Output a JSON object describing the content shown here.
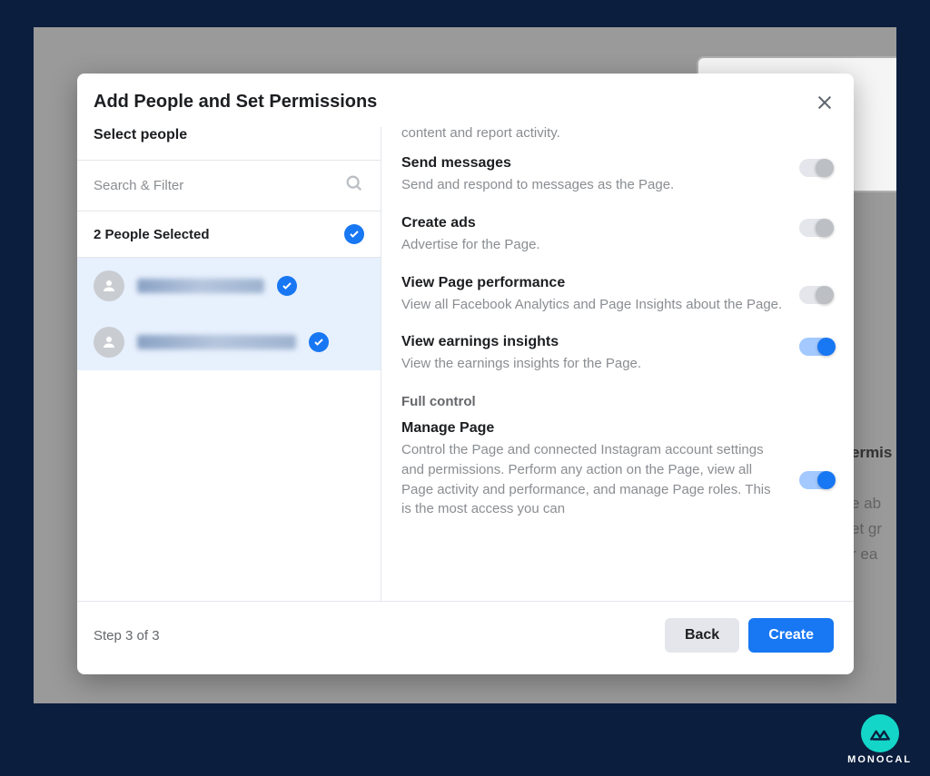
{
  "modal": {
    "title": "Add People and Set Permissions",
    "step_label": "Step 3 of 3",
    "back_label": "Back",
    "create_label": "Create"
  },
  "leftPanel": {
    "select_people_label": "Select people",
    "search_placeholder": "Search & Filter",
    "selected_count_label": "2 People Selected"
  },
  "permissions": {
    "truncated_top": "content and report activity.",
    "items": [
      {
        "title": "Send messages",
        "desc": "Send and respond to messages as the Page.",
        "enabled": false
      },
      {
        "title": "Create ads",
        "desc": "Advertise for the Page.",
        "enabled": false
      },
      {
        "title": "View Page performance",
        "desc": "View all Facebook Analytics and Page Insights about the Page.",
        "enabled": false
      },
      {
        "title": "View earnings insights",
        "desc": "View the earnings insights for the Page.",
        "enabled": true
      }
    ],
    "full_control_label": "Full control",
    "manage_page": {
      "title": "Manage Page",
      "desc": "Control the Page and connected Instagram account settings and permissions. Perform any action on the Page, view all Page activity and performance, and manage Page roles. This is the most access you can",
      "enabled": true
    }
  },
  "bg": {
    "line1": "ermis",
    "line2": "e ab",
    "line3": "et gr",
    "line4": "r ea"
  },
  "brand": {
    "name": "MONOCAL"
  }
}
